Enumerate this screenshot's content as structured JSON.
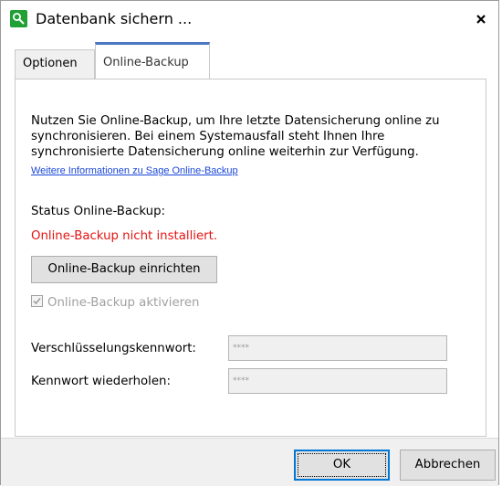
{
  "window": {
    "title": "Datenbank sichern ...",
    "icons": {
      "app": "key-search-icon",
      "close": "close-icon"
    }
  },
  "tabs": [
    {
      "label": "Optionen",
      "active": false
    },
    {
      "label": "Online-Backup",
      "active": true
    }
  ],
  "panel": {
    "intro_lines": [
      "Nutzen Sie Online-Backup, um Ihre letzte Datensicherung online zu",
      "synchronisieren. Bei einem Systemausfall steht Ihnen Ihre",
      "synchronisierte Datensicherung online weiterhin zur Verfügung."
    ],
    "info_link": "Weitere Informationen zu Sage Online-Backup",
    "status_label": "Status Online-Backup:",
    "status_value": "Online-Backup nicht installiert.",
    "setup_button": "Online-Backup einrichten",
    "activate_checkbox": {
      "label": "Online-Backup aktivieren",
      "checked": true,
      "disabled": true
    },
    "password_label": "Verschlüsselungskennwort:",
    "password_value": "****",
    "repeat_label": "Kennwort wiederholen:",
    "repeat_value": "****"
  },
  "buttons": {
    "ok": "OK",
    "cancel": "Abbrechen"
  },
  "colors": {
    "accent": "#0078d7",
    "tab_accent": "#4b78c2",
    "error": "#e51313",
    "link": "#1a47d6",
    "app_icon": "#21a035"
  }
}
